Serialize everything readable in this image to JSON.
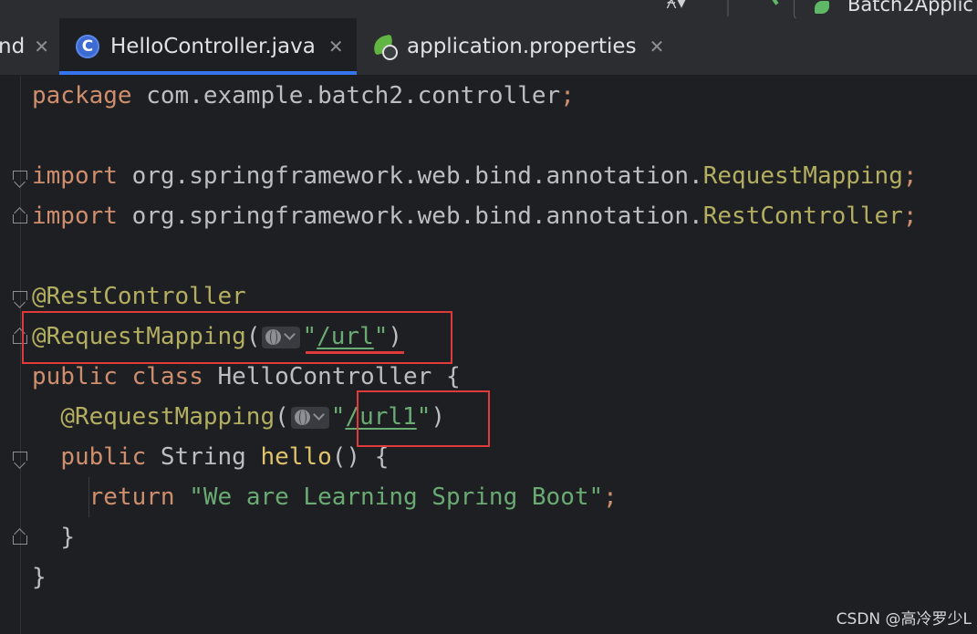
{
  "toolbar": {
    "run_config_label": "Batch2Applic",
    "vcs_icon": "user-plus-icon",
    "build_icon": "hammer-icon"
  },
  "tabs": [
    {
      "label": "nd",
      "icon": "none",
      "active": false
    },
    {
      "label": "HelloController.java",
      "icon": "class-c-icon",
      "active": true
    },
    {
      "label": "application.properties",
      "icon": "spring-boot-icon",
      "active": false
    }
  ],
  "code": {
    "package_kw": "package",
    "package_name": " com.example.batch2.controller",
    "semicolon": ";",
    "import_kw": "import",
    "import1_path": " org.springframework.web.bind.annotation.",
    "import1_class": "RequestMapping",
    "import2_path": " org.springframework.web.bind.annotation.",
    "import2_class": "RestController",
    "rest_controller": "@RestController",
    "request_mapping": "@RequestMapping",
    "open_paren": "(",
    "close_paren": ")",
    "quote": "\"",
    "url_path": "/url",
    "url1_path": "/url1",
    "public_kw": "public",
    "class_kw": "class",
    "class_name": " HelloController ",
    "open_brace": "{",
    "close_brace": "}",
    "string_type": " String ",
    "method_name": "hello",
    "method_parens": "() ",
    "return_kw": "return",
    "return_str": "\"We are Learning Spring Boot\""
  },
  "colors": {
    "keyword": "#cf8e6d",
    "annotation": "#b3ae60",
    "string": "#6aab73",
    "method": "#e0c36a",
    "highlight_box": "#e03a3a"
  },
  "watermark": "CSDN @高冷罗少L"
}
